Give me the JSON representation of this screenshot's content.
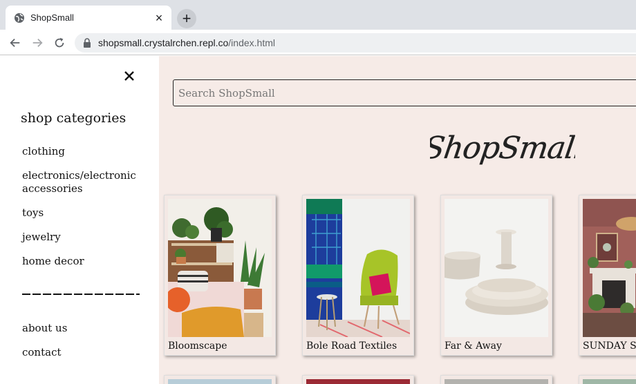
{
  "browser": {
    "tab_title": "ShopSmall",
    "tab_close": "×",
    "new_tab": "+",
    "url_host": "shopsmall.crystalrchen.repl.co",
    "url_path": "/index.html"
  },
  "sidebar": {
    "heading": "shop categories",
    "categories": [
      {
        "label": "clothing"
      },
      {
        "label": "electronics/electronic accessories"
      },
      {
        "label": "toys"
      },
      {
        "label": "jewelry"
      },
      {
        "label": "home decor"
      }
    ],
    "links": [
      {
        "label": "about us"
      },
      {
        "label": "contact"
      }
    ]
  },
  "main": {
    "search_placeholder": "Search ShopSmall",
    "logo_text": "ShopSmall",
    "shops": [
      {
        "name": "Bloomscape"
      },
      {
        "name": "Bole Road Textiles"
      },
      {
        "name": "Far & Away"
      },
      {
        "name": "SUNDAY SH"
      }
    ]
  },
  "colors": {
    "main_bg": "#f6ebe7",
    "card_bg": "#f3e8e4",
    "chrome_bg": "#dee1e6"
  }
}
